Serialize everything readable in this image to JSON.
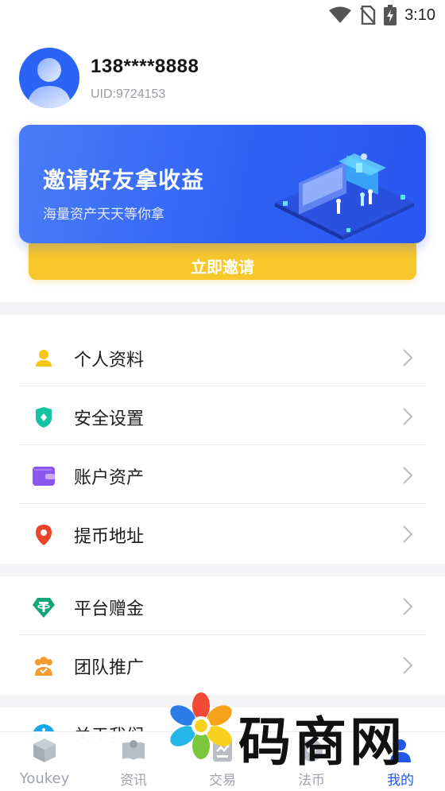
{
  "status_bar": {
    "time": "3:10",
    "icons": [
      "wifi-icon",
      "no-sim-icon",
      "battery-charging-icon"
    ]
  },
  "profile": {
    "phone": "138****8888",
    "uid": "UID:9724153"
  },
  "banner": {
    "title": "邀请好友拿收益",
    "subtitle": "海量资产天天等你拿",
    "button_label": "立即邀请"
  },
  "menu_group_1": [
    {
      "label": "个人资料",
      "icon": "person-icon",
      "color": "#f5c518"
    },
    {
      "label": "安全设置",
      "icon": "shield-icon",
      "color": "#17c3a4"
    },
    {
      "label": "账户资产",
      "icon": "wallet-icon",
      "color": "#8b55f0"
    },
    {
      "label": "提币地址",
      "icon": "location-pin-icon",
      "color": "#e8452c"
    }
  ],
  "menu_group_2": [
    {
      "label": "平台赠金",
      "icon": "tether-icon",
      "color": "#12a57a"
    },
    {
      "label": "团队推广",
      "icon": "team-icon",
      "color": "#f59a2e"
    }
  ],
  "menu_group_3": [
    {
      "label": "关于我们",
      "icon": "info-icon",
      "color": "#1aa8e8"
    }
  ],
  "tabs": [
    {
      "label": "Youkey",
      "icon": "cube-icon",
      "active": false
    },
    {
      "label": "资讯",
      "icon": "news-icon",
      "active": false
    },
    {
      "label": "交易",
      "icon": "trade-icon",
      "active": false
    },
    {
      "label": "法币",
      "icon": "fiat-icon",
      "active": false
    },
    {
      "label": "我的",
      "icon": "user-icon",
      "active": true
    }
  ],
  "watermark": {
    "text": "码商网"
  },
  "colors": {
    "accent": "#2457e8",
    "banner": "#3a6af6",
    "button": "#f8c72b"
  }
}
